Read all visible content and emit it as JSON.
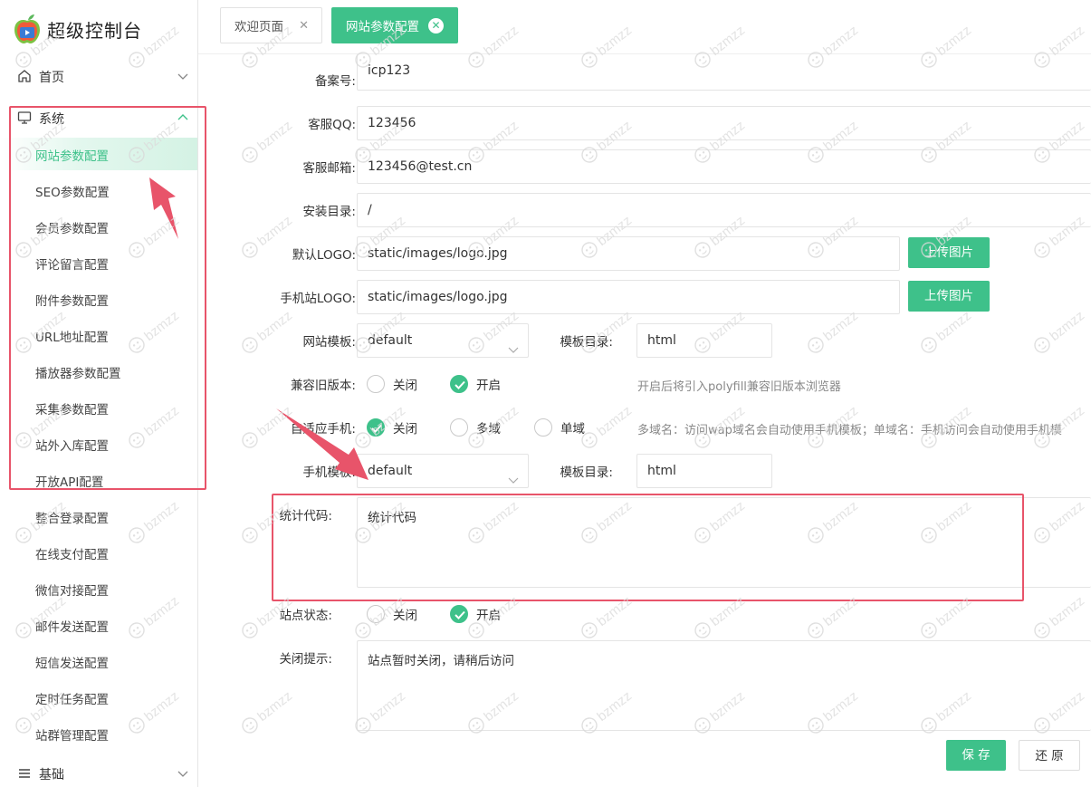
{
  "brand": {
    "title": "超级控制台"
  },
  "sidebar": {
    "groups": [
      {
        "label": "首页",
        "icon": "home-icon"
      },
      {
        "label": "系统",
        "icon": "monitor-icon"
      },
      {
        "label": "基础",
        "icon": "list-icon"
      }
    ],
    "items": [
      {
        "label": "网站参数配置"
      },
      {
        "label": "SEO参数配置"
      },
      {
        "label": "会员参数配置"
      },
      {
        "label": "评论留言配置"
      },
      {
        "label": "附件参数配置"
      },
      {
        "label": "URL地址配置"
      },
      {
        "label": "播放器参数配置"
      },
      {
        "label": "采集参数配置"
      },
      {
        "label": "站外入库配置"
      },
      {
        "label": "开放API配置"
      },
      {
        "label": "整合登录配置"
      },
      {
        "label": "在线支付配置"
      },
      {
        "label": "微信对接配置"
      },
      {
        "label": "邮件发送配置"
      },
      {
        "label": "短信发送配置"
      },
      {
        "label": "定时任务配置"
      },
      {
        "label": "站群管理配置"
      }
    ]
  },
  "tabs": [
    {
      "label": "欢迎页面"
    },
    {
      "label": "网站参数配置"
    }
  ],
  "form": {
    "icp": {
      "label": "备案号:",
      "value": "icp123"
    },
    "qq": {
      "label": "客服QQ:",
      "value": "123456"
    },
    "email": {
      "label": "客服邮箱:",
      "value": "123456@test.cn"
    },
    "install_dir": {
      "label": "安装目录:",
      "value": "/"
    },
    "logo": {
      "label": "默认LOGO:",
      "value": "static/images/logo.jpg",
      "button": "上传图片"
    },
    "mobile_logo": {
      "label": "手机站LOGO:",
      "value": "static/images/logo.jpg",
      "button": "上传图片"
    },
    "template": {
      "label": "网站模板:",
      "value": "default",
      "dir_label": "模板目录:",
      "dir_value": "html"
    },
    "compat": {
      "label": "兼容旧版本:",
      "options": [
        "关闭",
        "开启"
      ],
      "selected": 1,
      "hint": "开启后将引入polyfill兼容旧版本浏览器"
    },
    "mobile_adapt": {
      "label": "自适应手机:",
      "options": [
        "关闭",
        "多域",
        "单域"
      ],
      "selected": 0,
      "hint": "多域名：访问wap域名会自动使用手机模板；单域名：手机访问会自动使用手机模"
    },
    "mobile_template": {
      "label": "手机模板:",
      "value": "default",
      "dir_label": "模板目录:",
      "dir_value": "html"
    },
    "stats": {
      "label": "统计代码:",
      "value": "统计代码"
    },
    "status": {
      "label": "站点状态:",
      "options": [
        "关闭",
        "开启"
      ],
      "selected": 1
    },
    "close_tip": {
      "label": "关闭提示:",
      "value": "站点暂时关闭，请稍后访问"
    },
    "save": "保 存",
    "reset": "还 原"
  },
  "watermark": "bzmzz",
  "colors": {
    "accent": "#3ec18a",
    "annotation": "#e8546a"
  }
}
